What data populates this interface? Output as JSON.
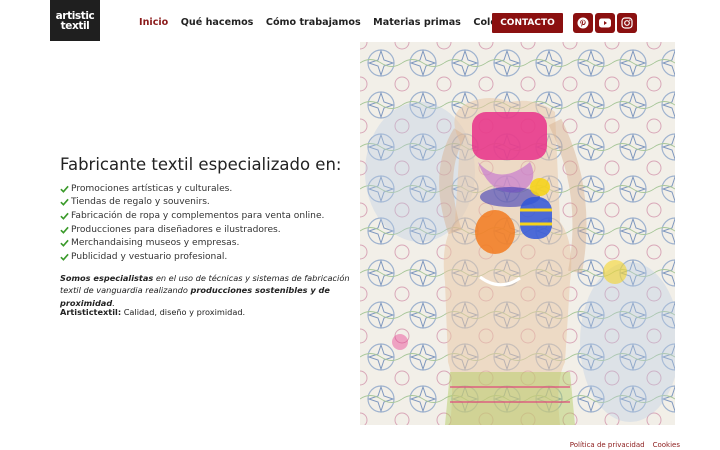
{
  "brand": {
    "logo_line1": "artistic",
    "logo_line2": "textil"
  },
  "nav": {
    "items": [
      {
        "label": "Inicio",
        "active": true
      },
      {
        "label": "Qué hacemos"
      },
      {
        "label": "Cómo trabajamos"
      },
      {
        "label": "Materias primas"
      },
      {
        "label": "Colecciones"
      }
    ],
    "contact_label": "CONTACTO"
  },
  "social": [
    {
      "icon": "pinterest-icon"
    },
    {
      "icon": "youtube-icon"
    },
    {
      "icon": "instagram-icon"
    }
  ],
  "hero": {
    "title": "Fabricante textil especializado en:",
    "features": [
      "Promociones artísticas y culturales.",
      "Tiendas de regalo y souvenirs.",
      "Fabricación de ropa y complementos para venta online.",
      "Producciones para diseñadores e ilustradores.",
      "Merchandaising museos y empresas.",
      "Publicidad y vestuario profesional."
    ],
    "para_strong": "Somos especialistas",
    "para_text": " en el uso de técnicas y sistemas de fabricación textil de vanguardia realizando ",
    "para_strong2": "producciones sostenibles y de proximidad",
    "para_end": ".",
    "tagline_strong": "Artistictextil:",
    "tagline_text": " Calidad, diseño y proximidad."
  },
  "footer": {
    "privacy": "Política de privacidad",
    "cookies": "Cookies"
  },
  "colors": {
    "accent": "#8b1010",
    "check": "#3a9a2a",
    "active_nav": "#8b1a1a"
  }
}
